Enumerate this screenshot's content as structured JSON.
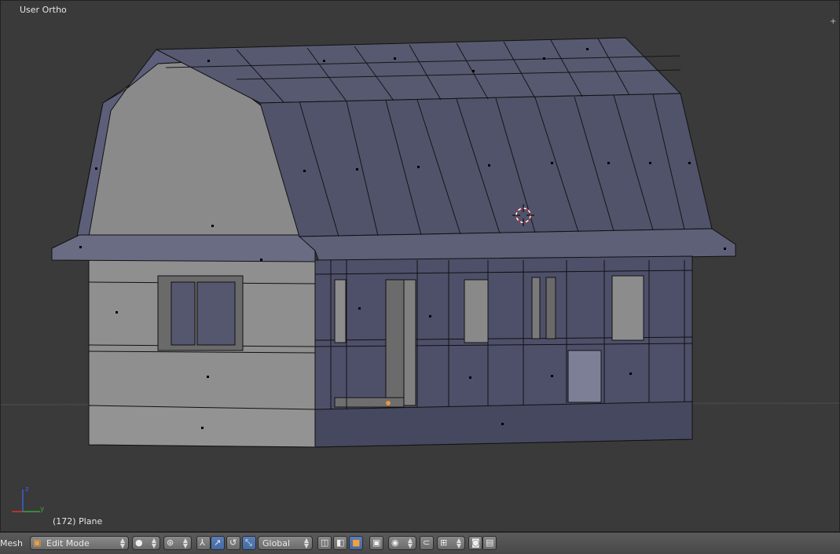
{
  "viewport": {
    "title": "User Ortho",
    "object_label": "(172) Plane"
  },
  "axes": {
    "z": "z",
    "y": "y"
  },
  "header": {
    "menu_label": "Mesh",
    "mode": "Edit Mode",
    "orientation": "Global"
  },
  "icons": [
    "mode-icon",
    "shading-sphere-icon",
    "pivot-icon",
    "manipulator-icon",
    "translate-icon",
    "rotate-icon",
    "scale-icon",
    "vertex-select-icon",
    "edge-select-icon",
    "face-select-icon",
    "limit-selection-icon",
    "proportional-icon",
    "snap-icon",
    "snap-element-icon",
    "render-icon",
    "render-anim-icon"
  ]
}
